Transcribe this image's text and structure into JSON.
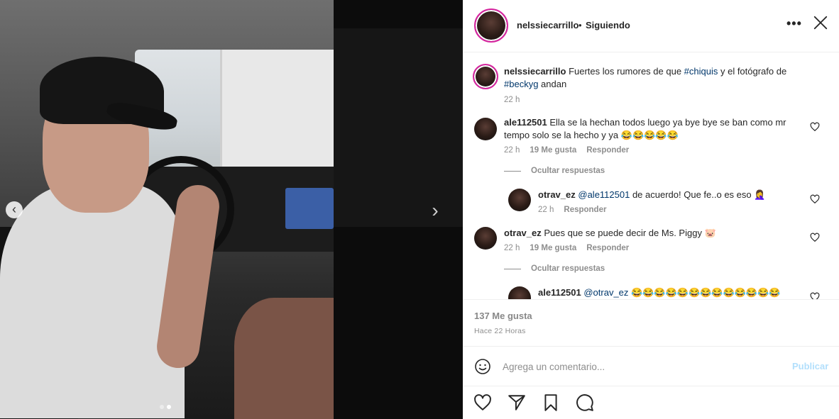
{
  "media": {
    "slide_count": 2,
    "active_slide": 2
  },
  "header": {
    "username": "nelssiecarrillo",
    "separator": "•",
    "follow_status": "Siguiendo"
  },
  "caption": {
    "username": "nelssiecarrillo",
    "text_before": "Fuertes los rumores de que ",
    "tag1": "#chiquis",
    "text_middle": " y el fotógrafo de ",
    "tag2": "#beckyg",
    "text_after": " andan",
    "time": "22 h"
  },
  "comments": [
    {
      "username": "ale112501",
      "text": "Ella se la hechan todos luego ya bye bye se ban como mr tempo solo se la hecho y ya 😂😂😂😂😂",
      "time": "22 h",
      "likes": "19 Me gusta",
      "reply_label": "Responder",
      "toggle_label": "Ocultar respuestas",
      "replies": [
        {
          "username": "otrav_ez",
          "mention": "@ale112501",
          "text": " de acuerdo! Que fe..o es eso 🤦‍♀️",
          "time": "22 h",
          "reply_label": "Responder"
        }
      ]
    },
    {
      "username": "otrav_ez",
      "text": "Pues que se puede decir de Ms. Piggy 🐷",
      "time": "22 h",
      "likes": "19 Me gusta",
      "reply_label": "Responder",
      "toggle_label": "Ocultar respuestas",
      "replies": [
        {
          "username": "ale112501",
          "mention": "@otrav_ez",
          "text": " 😂😂😂😂😂😂😂😂😂😂😂😂😂",
          "time": "",
          "reply_label": ""
        }
      ]
    }
  ],
  "likes": "137 Me gusta",
  "posted": "Hace 22 Horas",
  "comment_box": {
    "placeholder": "Agrega un comentario...",
    "publish_label": "Publicar"
  },
  "icons": [
    "chevron-left-icon",
    "chevron-right-icon",
    "more-icon",
    "close-icon",
    "heart-icon",
    "send-icon",
    "bookmark-icon",
    "comment-icon",
    "emoji-icon"
  ],
  "colors": {
    "link": "#00376b",
    "muted": "#8e8e8e",
    "publish_disabled": "#b2dffc",
    "text": "#262626"
  }
}
